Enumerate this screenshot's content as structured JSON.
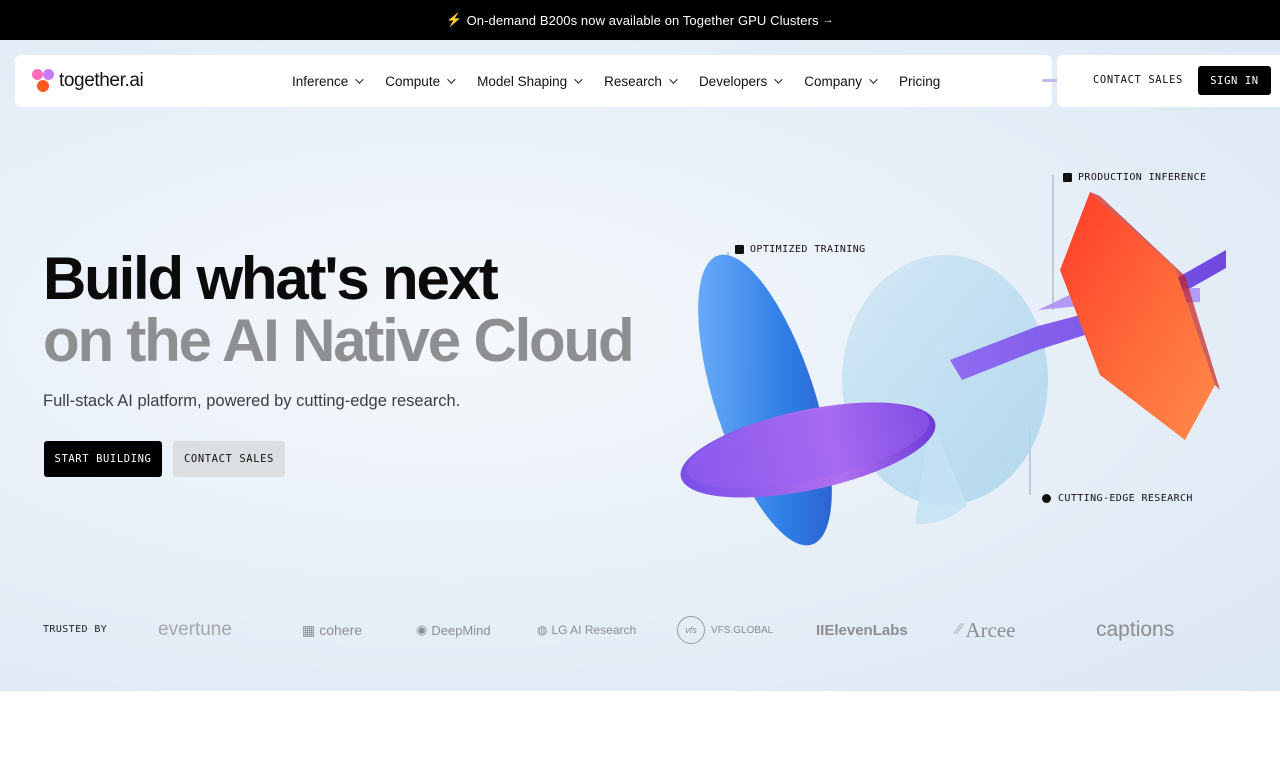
{
  "announcement": {
    "icon": "lightning-icon",
    "text": "On-demand B200s now available on Together GPU Clusters",
    "arrow": "→"
  },
  "brand": {
    "name": "together.ai",
    "colors": [
      "#ff6db8",
      "#c67bff",
      "#ff5a1f"
    ]
  },
  "nav": {
    "items": [
      {
        "label": "Inference",
        "has_dropdown": true
      },
      {
        "label": "Compute",
        "has_dropdown": true
      },
      {
        "label": "Model Shaping",
        "has_dropdown": true
      },
      {
        "label": "Research",
        "has_dropdown": true
      },
      {
        "label": "Developers",
        "has_dropdown": true
      },
      {
        "label": "Company",
        "has_dropdown": true
      },
      {
        "label": "Pricing",
        "has_dropdown": false
      }
    ],
    "contact_label": "CONTACT SALES",
    "signin_label": "SIGN IN"
  },
  "hero": {
    "headline_line1": "Build what's next",
    "headline_line2": "on the AI Native Cloud",
    "subtitle": "Full-stack AI platform, powered by cutting-edge research.",
    "primary_cta": "START BUILDING",
    "secondary_cta": "CONTACT SALES"
  },
  "illustration": {
    "tags": {
      "training": "OPTIMIZED TRAINING",
      "inference": "PRODUCTION INFERENCE",
      "research": "CUTTING-EDGE RESEARCH"
    }
  },
  "trusted": {
    "label": "TRUSTED BY",
    "logos": [
      "evertune",
      "cohere",
      "DeepMind",
      "LG AI Research",
      "VFS.GLOBAL",
      "IIElevenLabs",
      "Arcee",
      "captions"
    ]
  }
}
